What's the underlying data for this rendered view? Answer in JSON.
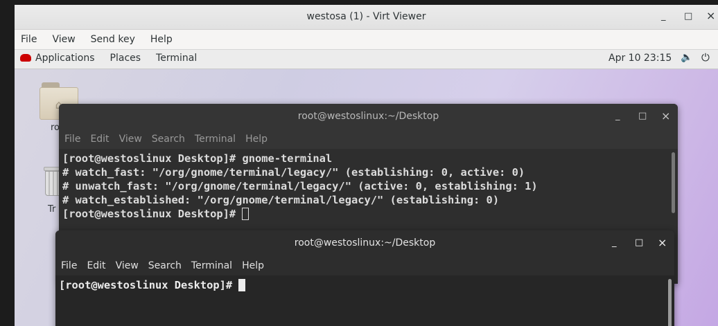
{
  "viewer": {
    "title": "westosa (1) - Virt Viewer",
    "menu": [
      "File",
      "View",
      "Send key",
      "Help"
    ],
    "minimize": "_",
    "maximize": "□",
    "close": "×"
  },
  "topbar": {
    "applications": "Applications",
    "places": "Places",
    "terminal": "Terminal",
    "clock": "Apr 10  23:15",
    "volume_icon": "🔈",
    "power_icon": "⏻"
  },
  "desktop": {
    "home_label": "ro",
    "trash_label": "Tr"
  },
  "terminal1": {
    "title": "root@westoslinux:~/Desktop",
    "menu": [
      "File",
      "Edit",
      "View",
      "Search",
      "Terminal",
      "Help"
    ],
    "lines": [
      "[root@westoslinux Desktop]# gnome-terminal",
      "# watch_fast: \"/org/gnome/terminal/legacy/\" (establishing: 0, active: 0)",
      "# unwatch_fast: \"/org/gnome/terminal/legacy/\" (active: 0, establishing: 1)",
      "# watch_established: \"/org/gnome/terminal/legacy/\" (establishing: 0)",
      "[root@westoslinux Desktop]# "
    ]
  },
  "terminal2": {
    "title": "root@westoslinux:~/Desktop",
    "menu": [
      "File",
      "Edit",
      "View",
      "Search",
      "Terminal",
      "Help"
    ],
    "lines": [
      "[root@westoslinux Desktop]# "
    ]
  },
  "window_controls": {
    "minimize": "_",
    "maximize": "□",
    "close": "×"
  }
}
